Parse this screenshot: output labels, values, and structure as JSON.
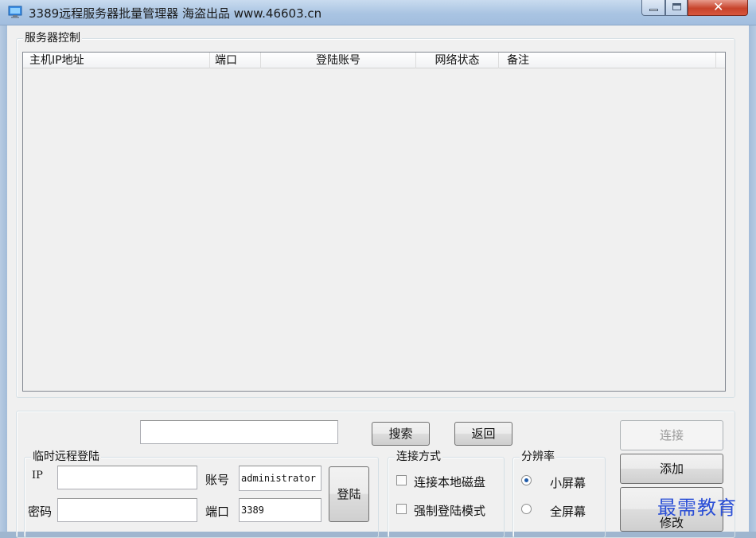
{
  "window": {
    "title": "3389远程服务器批量管理器 海盗出品 www.46603.cn"
  },
  "server_control": {
    "legend": "服务器控制",
    "columns": [
      "主机IP地址",
      "端口",
      "登陆账号",
      "网络状态",
      "备注"
    ],
    "rows": []
  },
  "toolbar": {
    "search_value": "",
    "search_label": "搜索",
    "back_label": "返回"
  },
  "actions": {
    "connect_label": "连接",
    "add_label": "添加",
    "modify_label": "修改"
  },
  "temp_login": {
    "legend": "临时远程登陆",
    "ip_label": "IP",
    "ip_value": "",
    "password_label": "密码",
    "password_value": "",
    "account_label": "账号",
    "account_value": "administrator",
    "port_label": "端口",
    "port_value": "3389",
    "login_label": "登陆"
  },
  "connect_mode": {
    "legend": "连接方式",
    "options": [
      {
        "label": "连接本地磁盘",
        "checked": false
      },
      {
        "label": "强制登陆模式",
        "checked": false
      }
    ]
  },
  "resolution": {
    "legend": "分辨率",
    "options": [
      {
        "label": "小屏幕",
        "selected": true
      },
      {
        "label": "全屏幕",
        "selected": false
      }
    ]
  },
  "watermark": {
    "text": "最需教育"
  },
  "colors": {
    "titlebar": "#a9c4e2",
    "close_button": "#c7432b",
    "client_bg": "#f0f0f0",
    "watermark": "#2b4fd6"
  }
}
